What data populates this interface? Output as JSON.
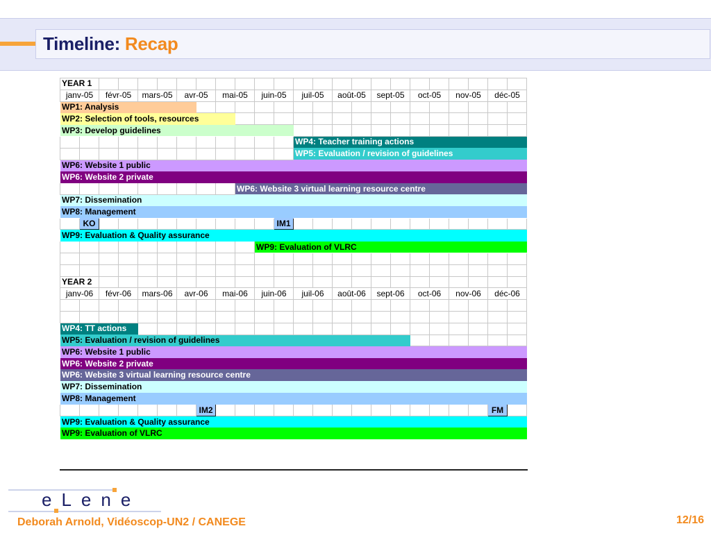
{
  "header": {
    "title": "Timeline:",
    "subtitle": "Recap"
  },
  "months_year1": [
    "janv-05",
    "févr-05",
    "mars-05",
    "avr-05",
    "mai-05",
    "juin-05",
    "juil-05",
    "août-05",
    "sept-05",
    "oct-05",
    "nov-05",
    "déc-05"
  ],
  "months_year2": [
    "janv-06",
    "févr-06",
    "mars-06",
    "avr-06",
    "mai-06",
    "juin-06",
    "juil-06",
    "août-06",
    "sept-06",
    "oct-06",
    "nov-06",
    "déc-06"
  ],
  "colors": {
    "wp1": "#ffcc99",
    "wp2": "#ffff99",
    "wp3": "#ccffcc",
    "wp4": "#008080",
    "wp5": "#33cccc",
    "wp6_public": "#cc99ff",
    "wp6_private": "#800080",
    "wp6_vlrc": "#666699",
    "wp7": "#ccffff",
    "wp8": "#99ccff",
    "wp9_quality": "#00ffff",
    "wp9_vlrc": "#00ff00",
    "milestone": "#9ec9ff"
  },
  "rows": [
    {
      "type": "label",
      "text": "YEAR 1"
    },
    {
      "type": "months",
      "year": 1
    },
    {
      "type": "bar",
      "text": "WP1: Analysis",
      "start": 0,
      "span": 7,
      "color": "wp1",
      "fg": "#000000"
    },
    {
      "type": "bar",
      "text": "WP2: Selection of tools, resources",
      "start": 0,
      "span": 9,
      "color": "wp2",
      "fg": "#000000"
    },
    {
      "type": "bar",
      "text": "WP3: Develop guidelines",
      "start": 0,
      "span": 12,
      "color": "wp3",
      "fg": "#000000"
    },
    {
      "type": "bar",
      "text": "WP4: Teacher training actions",
      "start": 12,
      "span": 12,
      "color": "wp4",
      "fg": "#ffffff"
    },
    {
      "type": "bar",
      "text": "WP5: Evaluation / revision of guidelines",
      "start": 12,
      "span": 12,
      "color": "wp5",
      "fg": "#ffffff"
    },
    {
      "type": "bar",
      "text": "WP6: Website 1 public",
      "start": 0,
      "span": 24,
      "color": "wp6_public",
      "fg": "#000000"
    },
    {
      "type": "bar",
      "text": "WP6: Website 2 private",
      "start": 0,
      "span": 24,
      "color": "wp6_private",
      "fg": "#ffffff"
    },
    {
      "type": "bar",
      "text": "WP6: Website 3 virtual learning resource centre",
      "start": 9,
      "span": 15,
      "color": "wp6_vlrc",
      "fg": "#ffffff"
    },
    {
      "type": "bar",
      "text": "WP7: Dissemination",
      "start": 0,
      "span": 24,
      "color": "wp7",
      "fg": "#000000"
    },
    {
      "type": "bar",
      "text": "WP8: Management",
      "start": 0,
      "span": 24,
      "color": "wp8",
      "fg": "#000000"
    },
    {
      "type": "milestones",
      "items": [
        {
          "text": "KO",
          "col": 1
        },
        {
          "text": "IM1",
          "col": 11
        }
      ]
    },
    {
      "type": "bar",
      "text": "WP9: Evaluation & Quality assurance",
      "start": 0,
      "span": 24,
      "color": "wp9_quality",
      "fg": "#000000"
    },
    {
      "type": "bar",
      "text": "WP9: Evaluation of VLRC",
      "start": 10,
      "span": 14,
      "color": "wp9_vlrc",
      "fg": "#000000"
    },
    {
      "type": "empty"
    },
    {
      "type": "empty"
    },
    {
      "type": "label",
      "text": "YEAR 2"
    },
    {
      "type": "months",
      "year": 2
    },
    {
      "type": "empty"
    },
    {
      "type": "empty"
    },
    {
      "type": "bar",
      "text": "WP4: TT actions",
      "start": 0,
      "span": 4,
      "color": "wp4",
      "fg": "#ffffff"
    },
    {
      "type": "bar",
      "text": "WP5: Evaluation / revision of guidelines",
      "start": 0,
      "span": 18,
      "color": "wp5",
      "fg": "#000000"
    },
    {
      "type": "bar",
      "text": "WP6: Website 1 public",
      "start": 0,
      "span": 24,
      "color": "wp6_public",
      "fg": "#000000"
    },
    {
      "type": "bar",
      "text": "WP6: Website 2 private",
      "start": 0,
      "span": 24,
      "color": "wp6_private",
      "fg": "#ffffff"
    },
    {
      "type": "bar",
      "text": "WP6: Website 3 virtual learning resource centre",
      "start": 0,
      "span": 24,
      "color": "wp6_vlrc",
      "fg": "#ffffff"
    },
    {
      "type": "bar",
      "text": "WP7: Dissemination",
      "start": 0,
      "span": 24,
      "color": "wp7",
      "fg": "#000000"
    },
    {
      "type": "bar",
      "text": "WP8: Management",
      "start": 0,
      "span": 24,
      "color": "wp8",
      "fg": "#000000"
    },
    {
      "type": "milestones",
      "items": [
        {
          "text": "IM2",
          "col": 7
        },
        {
          "text": "FM",
          "col": 22
        }
      ]
    },
    {
      "type": "bar",
      "text": "WP9: Evaluation & Quality assurance",
      "start": 0,
      "span": 24,
      "color": "wp9_quality",
      "fg": "#000000"
    },
    {
      "type": "bar",
      "text": "WP9: Evaluation of VLRC",
      "start": 0,
      "span": 24,
      "color": "wp9_vlrc",
      "fg": "#000000"
    }
  ],
  "logo": {
    "text": "eLene"
  },
  "footer": {
    "author": "Deborah Arnold, Vidéoscop-UN2 / CANEGE",
    "page": "12/16"
  }
}
